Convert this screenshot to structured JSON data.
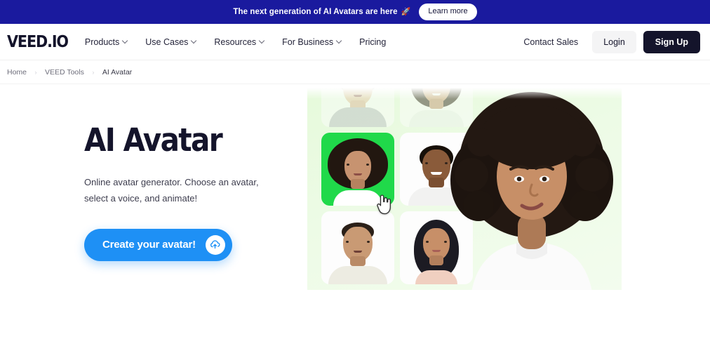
{
  "banner": {
    "text": "The next generation of AI Avatars are here",
    "rocket_icon": "rocket-icon",
    "rocket_glyph": "🚀",
    "cta_label": "Learn more",
    "background_color": "#1a1a9e"
  },
  "nav": {
    "logo": "VEED.IO",
    "links": [
      {
        "label": "Products",
        "has_dropdown": true
      },
      {
        "label": "Use Cases",
        "has_dropdown": true
      },
      {
        "label": "Resources",
        "has_dropdown": true
      },
      {
        "label": "For Business",
        "has_dropdown": true
      },
      {
        "label": "Pricing",
        "has_dropdown": false
      }
    ],
    "contact_sales": "Contact Sales",
    "login": "Login",
    "signup": "Sign Up"
  },
  "breadcrumb": {
    "separator": "›",
    "items": [
      {
        "label": "Home"
      },
      {
        "label": "VEED Tools"
      },
      {
        "label": "AI Avatar"
      }
    ]
  },
  "hero": {
    "title": "AI Avatar",
    "subtitle": "Online avatar generator. Choose an avatar, select a voice, and animate!",
    "cta_label": "Create your avatar!",
    "cta_icon": "cloud-upload-icon",
    "cta_color": "#1e90f5",
    "visual": {
      "background_color": "#e9fadf",
      "selected_tile_color": "#20d94a",
      "cursor_icon": "pointing-hand-cursor",
      "thumbnails": [
        {
          "name": "avatar-thumb-1",
          "selected": false,
          "faded": true
        },
        {
          "name": "avatar-thumb-2",
          "selected": false,
          "faded": true
        },
        {
          "name": "avatar-thumb-3",
          "selected": true,
          "faded": false
        },
        {
          "name": "avatar-thumb-4",
          "selected": false,
          "faded": false
        },
        {
          "name": "avatar-thumb-5",
          "selected": false,
          "faded": false
        },
        {
          "name": "avatar-thumb-6",
          "selected": false,
          "faded": false
        }
      ],
      "featured_avatar": "featured-avatar-portrait"
    }
  }
}
